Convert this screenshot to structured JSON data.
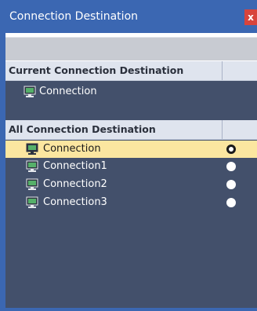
{
  "window": {
    "title": "Connection Destination",
    "close_glyph": "x"
  },
  "current_section": {
    "header": "Current Connection Destination",
    "items": [
      {
        "label": "Connection",
        "icon": "connection-pc-icon"
      }
    ]
  },
  "all_section": {
    "header": "All Connection Destination",
    "items": [
      {
        "label": "Connection",
        "icon": "connection-pc-icon",
        "selected": true,
        "radio_checked": true
      },
      {
        "label": "Connection1",
        "icon": "connection-pc-icon",
        "selected": false,
        "radio_checked": false
      },
      {
        "label": "Connection2",
        "icon": "connection-pc-icon",
        "selected": false,
        "radio_checked": false
      },
      {
        "label": "Connection3",
        "icon": "connection-pc-icon",
        "selected": false,
        "radio_checked": false
      }
    ]
  },
  "colors": {
    "title_bar": "#3b67b2",
    "content_bg": "#43506b",
    "section_header_bg": "#dfe4ee",
    "selected_row_bg": "#fbe6a0",
    "close_button": "#d8443c"
  }
}
